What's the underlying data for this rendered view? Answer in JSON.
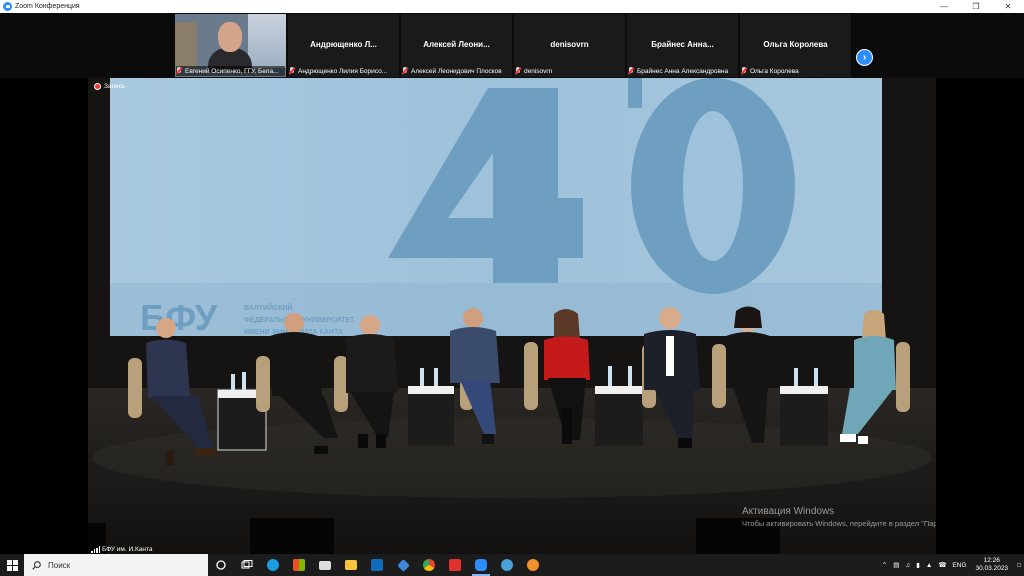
{
  "window": {
    "title": "Zoom Конференция"
  },
  "participants": [
    {
      "id": "p1",
      "video": true,
      "caption": "Евгений Осипенко, ГГУ, Бела..."
    },
    {
      "id": "p2",
      "name": "Андрющенко Л...",
      "caption": "Андрющенко Лилия Борисо..."
    },
    {
      "id": "p3",
      "name": "Алексей Леони...",
      "caption": "Алексей Леонидович Плосков"
    },
    {
      "id": "p4",
      "name": "denisovrn",
      "caption": "denisovrn"
    },
    {
      "id": "p5",
      "name": "Брайнес Анна...",
      "caption": "Брайнес Анна Александровна"
    },
    {
      "id": "p6",
      "name": "Ольга Королева",
      "caption": "Ольга Королева"
    }
  ],
  "next_button": {
    "icon": "chevron-right-icon"
  },
  "stage": {
    "recording_label": "Запись",
    "speaker_label": "БФУ им. И.Канта",
    "banner_big_number": "40",
    "banner_logo": "БФУ",
    "banner_logo_text": [
      "БАЛТИЙСКИЙ",
      "ФЕДЕРАЛЬНЫЙ УНИВЕРСИТЕТ",
      "ИМЕНИ ЭММАНУИЛА КАНТА"
    ],
    "activation": {
      "title": "Активация Windows",
      "subtitle": "Чтобы активировать Windows, перейдите в раздел \"Параметры\"."
    }
  },
  "taskbar": {
    "search_placeholder": "Поиск",
    "apps": [
      "task-view",
      "edge",
      "store",
      "mail",
      "explorer",
      "outlook",
      "download",
      "chrome",
      "vivaldi",
      "zoom",
      "pinwheel",
      "app-orange"
    ],
    "language": "ENG",
    "time": "12:26",
    "date": "30.03.2023"
  },
  "colors": {
    "zoom_blue": "#2d8cff",
    "banner_blue": "#9fc3dc",
    "taskbar": "#1c1c1c"
  }
}
